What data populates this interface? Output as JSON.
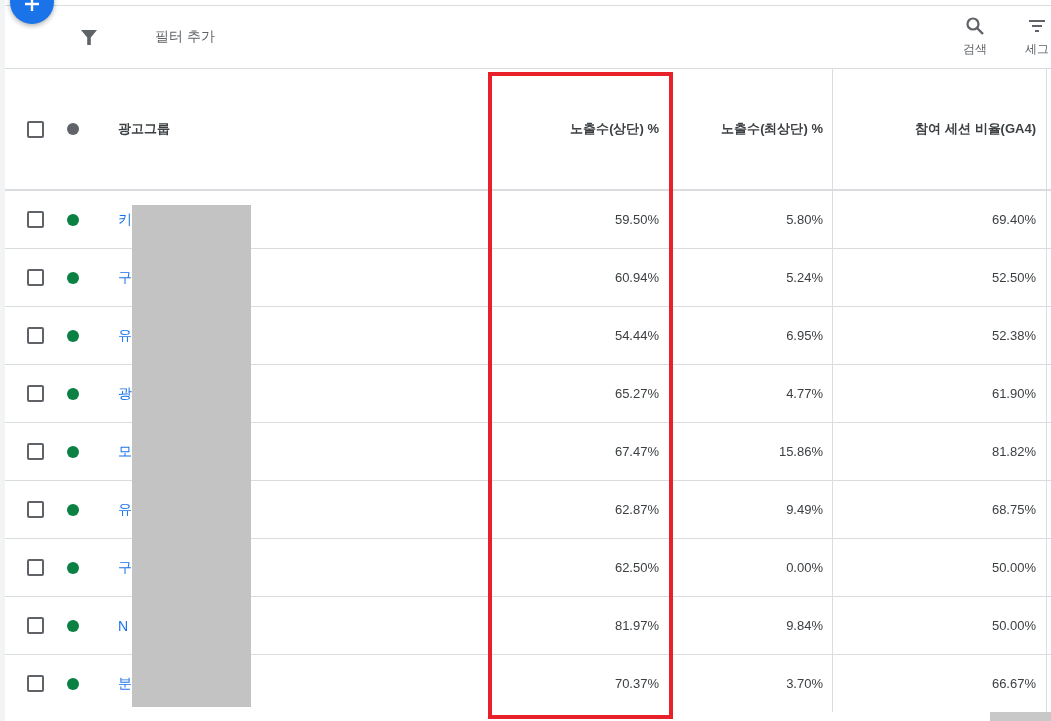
{
  "toolbar": {
    "filter_label": "필터 추가",
    "actions": [
      {
        "kind": "search",
        "label": "검색"
      },
      {
        "kind": "segment",
        "label": "세그"
      }
    ]
  },
  "table": {
    "columns": [
      "광고그룹",
      "노출수(상단) %",
      "노출수(최상단) %",
      "참여 세션 비율(GA4)"
    ],
    "all_checked": false,
    "rows": [
      {
        "checked": false,
        "color": "#0b8043",
        "name": "키",
        "values": [
          "59.50%",
          "5.80%",
          "69.40%"
        ]
      },
      {
        "checked": false,
        "color": "#0b8043",
        "name": "구",
        "values": [
          "60.94%",
          "5.24%",
          "52.50%"
        ]
      },
      {
        "checked": false,
        "color": "#0b8043",
        "name": "유",
        "values": [
          "54.44%",
          "6.95%",
          "52.38%"
        ]
      },
      {
        "checked": false,
        "color": "#0b8043",
        "name": "광",
        "values": [
          "65.27%",
          "4.77%",
          "61.90%"
        ]
      },
      {
        "checked": false,
        "color": "#0b8043",
        "name": "모",
        "values": [
          "67.47%",
          "15.86%",
          "81.82%"
        ]
      },
      {
        "checked": false,
        "color": "#0b8043",
        "name": "유",
        "values": [
          "62.87%",
          "9.49%",
          "68.75%"
        ]
      },
      {
        "checked": false,
        "color": "#0b8043",
        "name": "구",
        "values": [
          "62.50%",
          "0.00%",
          "50.00%"
        ]
      },
      {
        "checked": false,
        "color": "#0b8043",
        "name": "N",
        "values": [
          "81.97%",
          "9.84%",
          "50.00%"
        ]
      },
      {
        "checked": false,
        "color": "#0b8043",
        "name": "분",
        "values": [
          "70.37%",
          "3.70%",
          "66.67%"
        ]
      }
    ]
  }
}
